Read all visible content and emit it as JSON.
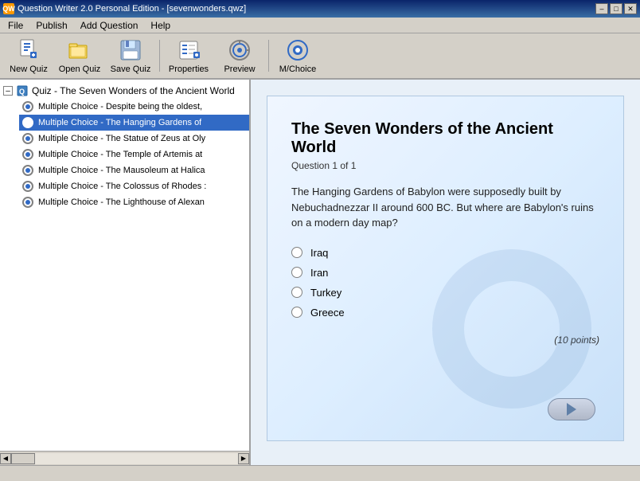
{
  "titlebar": {
    "icon_label": "QW",
    "title": "Question Writer 2.0 Personal Edition - [sevenwonders.qwz]",
    "btn_minimize": "–",
    "btn_maximize": "□",
    "btn_close": "✕"
  },
  "menu": {
    "items": [
      "File",
      "Publish",
      "Add Question",
      "Help"
    ]
  },
  "toolbar": {
    "buttons": [
      {
        "id": "new-quiz",
        "label": "New Quiz"
      },
      {
        "id": "open-quiz",
        "label": "Open Quiz"
      },
      {
        "id": "save-quiz",
        "label": "Save Quiz"
      },
      {
        "id": "properties",
        "label": "Properties"
      },
      {
        "id": "preview",
        "label": "Preview"
      },
      {
        "id": "mchoice",
        "label": "M/Choice"
      }
    ]
  },
  "tree": {
    "root_label": "Quiz - The Seven Wonders of the Ancient World",
    "items": [
      {
        "label": "Multiple Choice - Despite being the oldest,",
        "selected": false
      },
      {
        "label": "Multiple Choice - The Hanging Gardens of",
        "selected": true
      },
      {
        "label": "Multiple Choice - The Statue of Zeus at Oly",
        "selected": false
      },
      {
        "label": "Multiple Choice - The Temple of Artemis at",
        "selected": false
      },
      {
        "label": "Multiple Choice - The Mausoleum at Halica",
        "selected": false
      },
      {
        "label": "Multiple Choice - The Colossus of Rhodes :",
        "selected": false
      },
      {
        "label": "Multiple Choice - The Lighthouse of Alexan",
        "selected": false
      }
    ]
  },
  "preview": {
    "title": "The Seven Wonders of the Ancient World",
    "question_num": "Question 1 of 1",
    "body": "The Hanging Gardens of Babylon were supposedly built by Nebuchadnezzar II around 600 BC. But where are Babylon's ruins on a modern day map?",
    "options": [
      "Iraq",
      "Iran",
      "Turkey",
      "Greece"
    ],
    "points": "(10 points)"
  },
  "statusbar": {
    "text": ""
  }
}
